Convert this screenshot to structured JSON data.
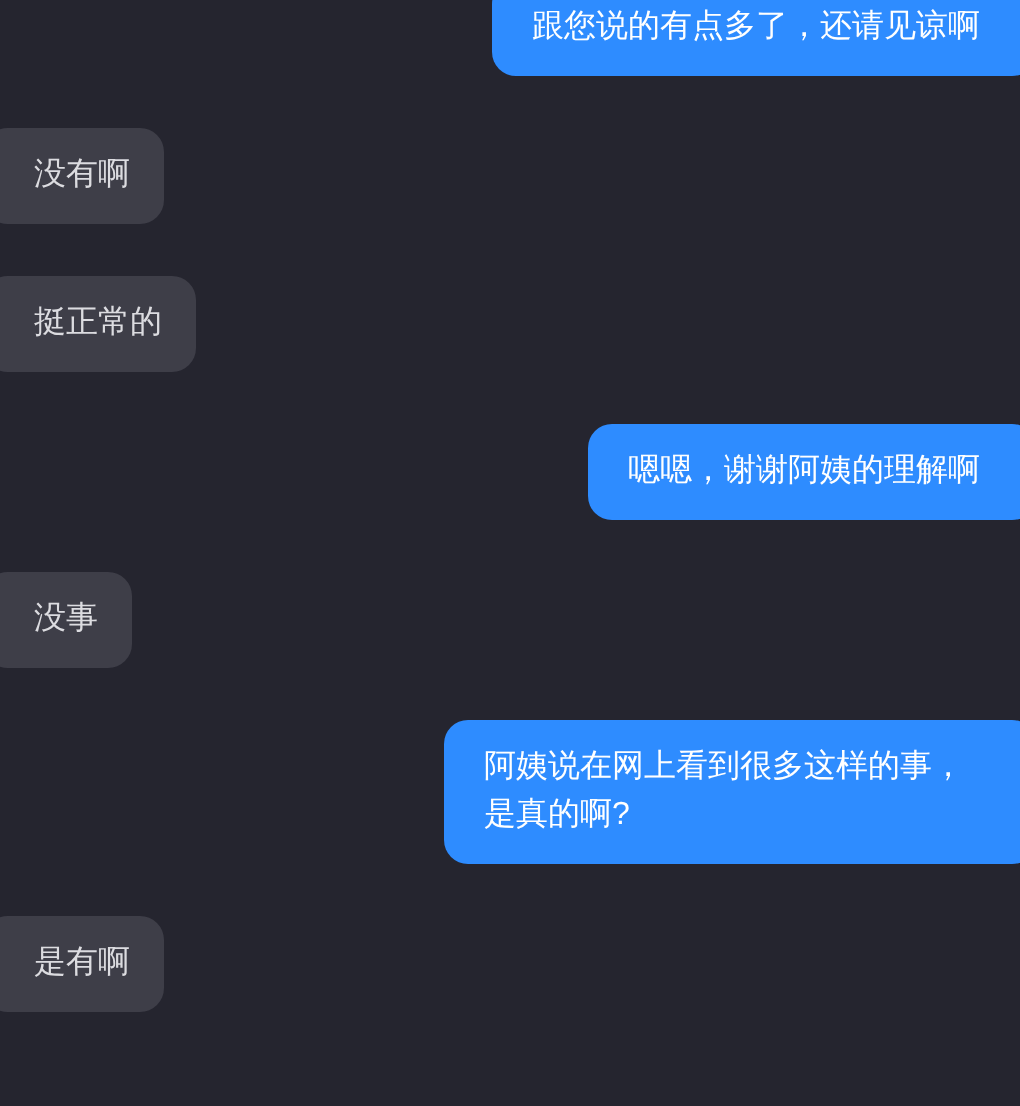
{
  "messages": [
    {
      "kind": "sent",
      "text": "跟您说的有点多了，还请见谅啊"
    },
    {
      "kind": "received",
      "text": "没有啊"
    },
    {
      "kind": "received",
      "text": "挺正常的"
    },
    {
      "kind": "sent",
      "text": "嗯嗯，谢谢阿姨的理解啊"
    },
    {
      "kind": "received",
      "text": "没事"
    },
    {
      "kind": "sent",
      "text": "阿姨说在网上看到很多这样的事，是真的啊?"
    },
    {
      "kind": "received",
      "text": "是有啊"
    }
  ]
}
